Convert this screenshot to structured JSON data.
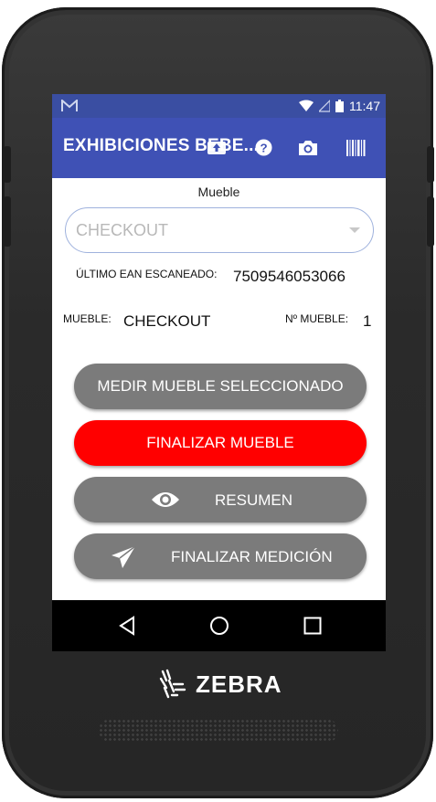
{
  "status_bar": {
    "time": "11:47"
  },
  "app_bar": {
    "title": "EXHIBICIONES BEBE..."
  },
  "form": {
    "field_label": "Mueble",
    "select_value": "CHECKOUT"
  },
  "info": {
    "last_ean_label": "ÚLTIMO EAN ESCANEADO:",
    "last_ean_value": "7509546053066",
    "mueble_label": "MUEBLE:",
    "mueble_value": "CHECKOUT",
    "mueble_num_label": "Nº MUEBLE:",
    "mueble_num_value": "1"
  },
  "buttons": {
    "measure": "MEDIR MUEBLE SELECCIONADO",
    "finish_mueble": "FINALIZAR MUEBLE",
    "summary": "RESUMEN",
    "finish_measure": "FINALIZAR MEDICIÓN"
  },
  "device": {
    "brand": "ZEBRA"
  },
  "colors": {
    "primary": "#3f51b5",
    "status": "#3a4ea2",
    "danger": "#ff0000",
    "button_gray": "#7b7b7b"
  }
}
